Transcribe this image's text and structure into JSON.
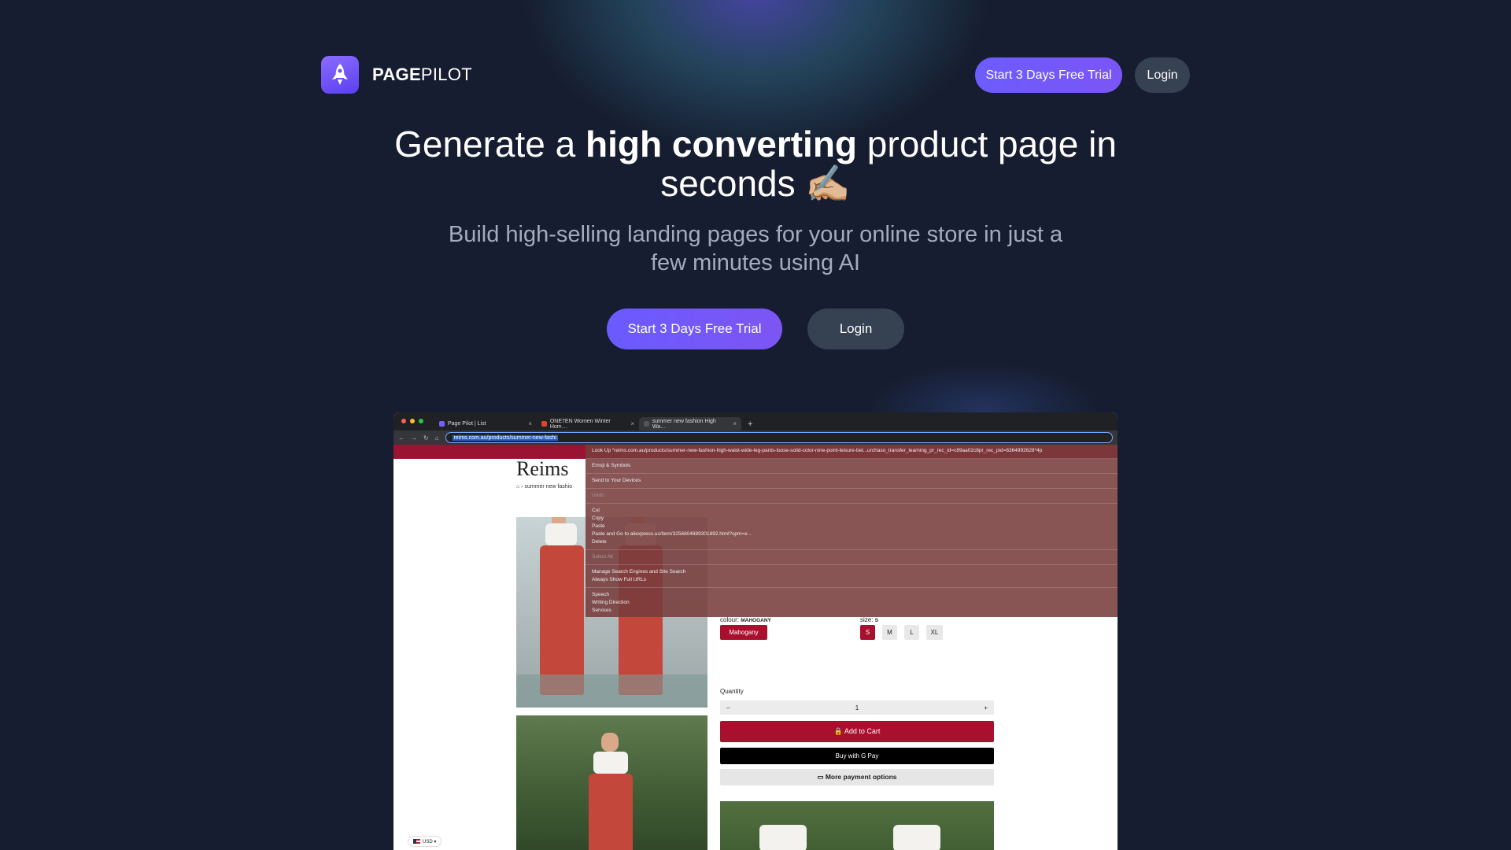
{
  "brand": {
    "name_bold": "PAGE",
    "name_light": "PILOT",
    "accent": "#6d5cff"
  },
  "header": {
    "trial_label": "Start 3 Days Free Trial",
    "login_label": "Login"
  },
  "hero": {
    "title_pre": "Generate a ",
    "title_bold": "high converting",
    "title_post": " product page in seconds ✍🏼",
    "subtitle": "Build high-selling landing pages for your online store in just a few minutes using AI",
    "cta_trial": "Start 3 Days Free Trial",
    "cta_login": "Login"
  },
  "browser": {
    "tabs": [
      {
        "label": "Page Pilot | List",
        "close": "×"
      },
      {
        "label": "ONE7EN Women Winter Hom…",
        "close": "×"
      },
      {
        "label": "summer new fashion High Wa…",
        "close": "×"
      }
    ],
    "new_tab": "+",
    "url": "reims.com.au/products/summer-new-fashi",
    "context_menu": {
      "look_up": "Look Up “reims.com.au/products/summer-new-fashion-high-waist-wide-leg-pants-loose-solid-color-nine-point-leisure-bel...urchaso_transfer_learning_pr_rec_id=c89aa02c8pr_rec_pid=8364992628*4p",
      "groups": [
        [
          "Emoji & Symbols"
        ],
        [
          "Send to Your Devices"
        ],
        [
          "Undo"
        ],
        [
          "Cut",
          "Copy",
          "Paste",
          "Paste and Go to aliexpress.us/item/3256804889301892.html?spm=e…",
          "Delete"
        ],
        [
          "Select All"
        ],
        [
          "Manage Search Engines and Site Search",
          "Always Show Full URLs"
        ],
        [
          "Speech",
          "Writing Direction",
          "Services"
        ]
      ]
    }
  },
  "store": {
    "logo": "Reims",
    "breadcrumb": "⌂  ›  summer new fashio",
    "colour_label": "colour:",
    "colour_value": "MAHOGANY",
    "colour_chip": "Mahogany",
    "size_label": "size:",
    "size_value": "S",
    "sizes": [
      "S",
      "M",
      "L",
      "XL"
    ],
    "quantity_label": "Quantity",
    "qty_minus": "−",
    "qty_value": "1",
    "qty_plus": "+",
    "add_to_cart": "🔒 Add to Cart",
    "buy_with": "Buy with G Pay",
    "more_payment": "▭ More payment options",
    "currency": "USD ▾",
    "brand_red": "#a8102e"
  }
}
